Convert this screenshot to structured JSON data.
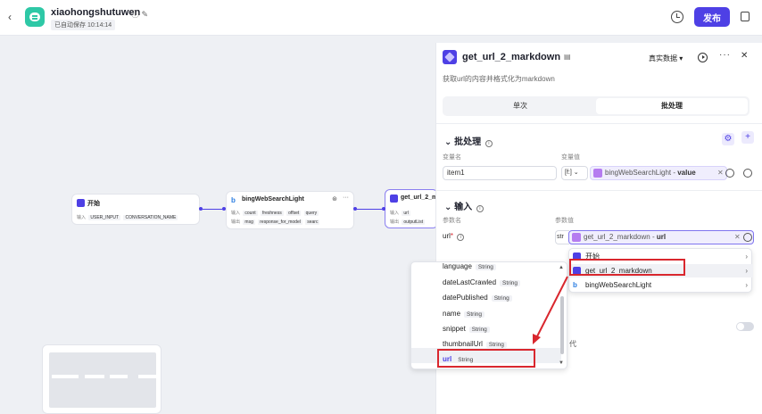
{
  "header": {
    "back_icon": "chevron-left-icon",
    "app_name": "xiaohongshutuwen",
    "saved_status": "已自动保存 10:14:14",
    "publish_label": "发布"
  },
  "canvas": {
    "nodes": [
      {
        "title": "开始",
        "row1_label": "输入",
        "row1_tags": [
          "USER_INPUT",
          "CONVERSATION_NAME"
        ]
      },
      {
        "title": "bingWebSearchLight",
        "row1_label": "输入",
        "row1_tags": [
          "count",
          "freshness",
          "offset",
          "query"
        ],
        "row2_label": "输出",
        "row2_tags": [
          "msg",
          "response_for_model",
          "searc"
        ]
      },
      {
        "title": "get_url_2_m",
        "row1_label": "输入",
        "row1_tags": [
          "url"
        ],
        "row2_label": "输出",
        "row2_tags": [
          "outputList"
        ]
      }
    ]
  },
  "panel": {
    "title": "get_url_2_markdown",
    "real_data": "真实数据 ▾",
    "description": "获取url的内容并格式化为markdown",
    "tabs": [
      {
        "label": "单次"
      },
      {
        "label": "批处理"
      }
    ],
    "batch": {
      "title": "批处理",
      "col_name": "变量名",
      "col_value": "变量值",
      "var_name": "item1",
      "type_sel": "[f:]",
      "ref_source": "bingWebSearchLight",
      "ref_sep": " - ",
      "ref_field": "value"
    },
    "input": {
      "title": "输入",
      "col_name": "参数名",
      "col_value": "参数值",
      "param_name": "url",
      "type_prefix": "str",
      "ref_source": "get_url_2_markdown",
      "ref_sep": " - ",
      "ref_field": "url"
    },
    "hidden_label": "代"
  },
  "dropdown_nodes": [
    {
      "label": "开始"
    },
    {
      "label": "get_url_2_markdown"
    },
    {
      "label": "bingWebSearchLight"
    }
  ],
  "dropdown_fields": [
    {
      "name": "language",
      "type": "String"
    },
    {
      "name": "dateLastCrawled",
      "type": "String"
    },
    {
      "name": "datePublished",
      "type": "String"
    },
    {
      "name": "name",
      "type": "String"
    },
    {
      "name": "snippet",
      "type": "String"
    },
    {
      "name": "thumbnailUrl",
      "type": "String"
    },
    {
      "name": "url",
      "type": "String"
    }
  ],
  "colors": {
    "accent": "#4e40e5",
    "annotation": "#d9272e",
    "app_icon": "#2ec8a6"
  }
}
